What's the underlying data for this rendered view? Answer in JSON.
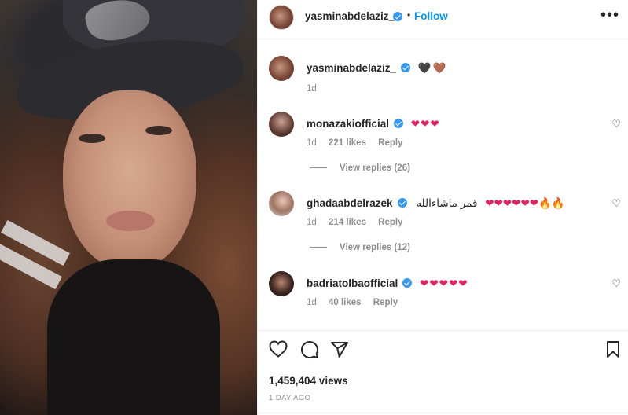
{
  "post": {
    "author": "yasminabdelaziz_",
    "follow_label": "Follow",
    "dot": "•",
    "more_label": "•••"
  },
  "caption": {
    "username": "yasminabdelaziz_",
    "emojis": "🖤🤎",
    "time": "1d"
  },
  "comments": [
    {
      "username": "monazakiofficial",
      "text": "",
      "emojis": "❤❤❤",
      "time": "1d",
      "likes": "221 likes",
      "reply_label": "Reply",
      "view_replies": "View replies (26)"
    },
    {
      "username": "ghadaabdelrazek",
      "text": "قمر ماشاءالله",
      "emojis": "❤❤❤❤❤❤🔥🔥",
      "time": "1d",
      "likes": "214 likes",
      "reply_label": "Reply",
      "view_replies": "View replies (12)"
    },
    {
      "username": "badriatolbaofficial",
      "text": "",
      "emojis": "❤❤❤❤❤",
      "time": "1d",
      "likes": "40 likes",
      "reply_label": "Reply",
      "view_replies": ""
    }
  ],
  "actions": {
    "views": "1,459,404 views",
    "posted": "1 DAY AGO"
  },
  "colors": {
    "link_blue": "#0095f6",
    "verified_blue": "#3897f0",
    "heart_red": "#e0245e",
    "muted_text": "#8e8e8e"
  }
}
